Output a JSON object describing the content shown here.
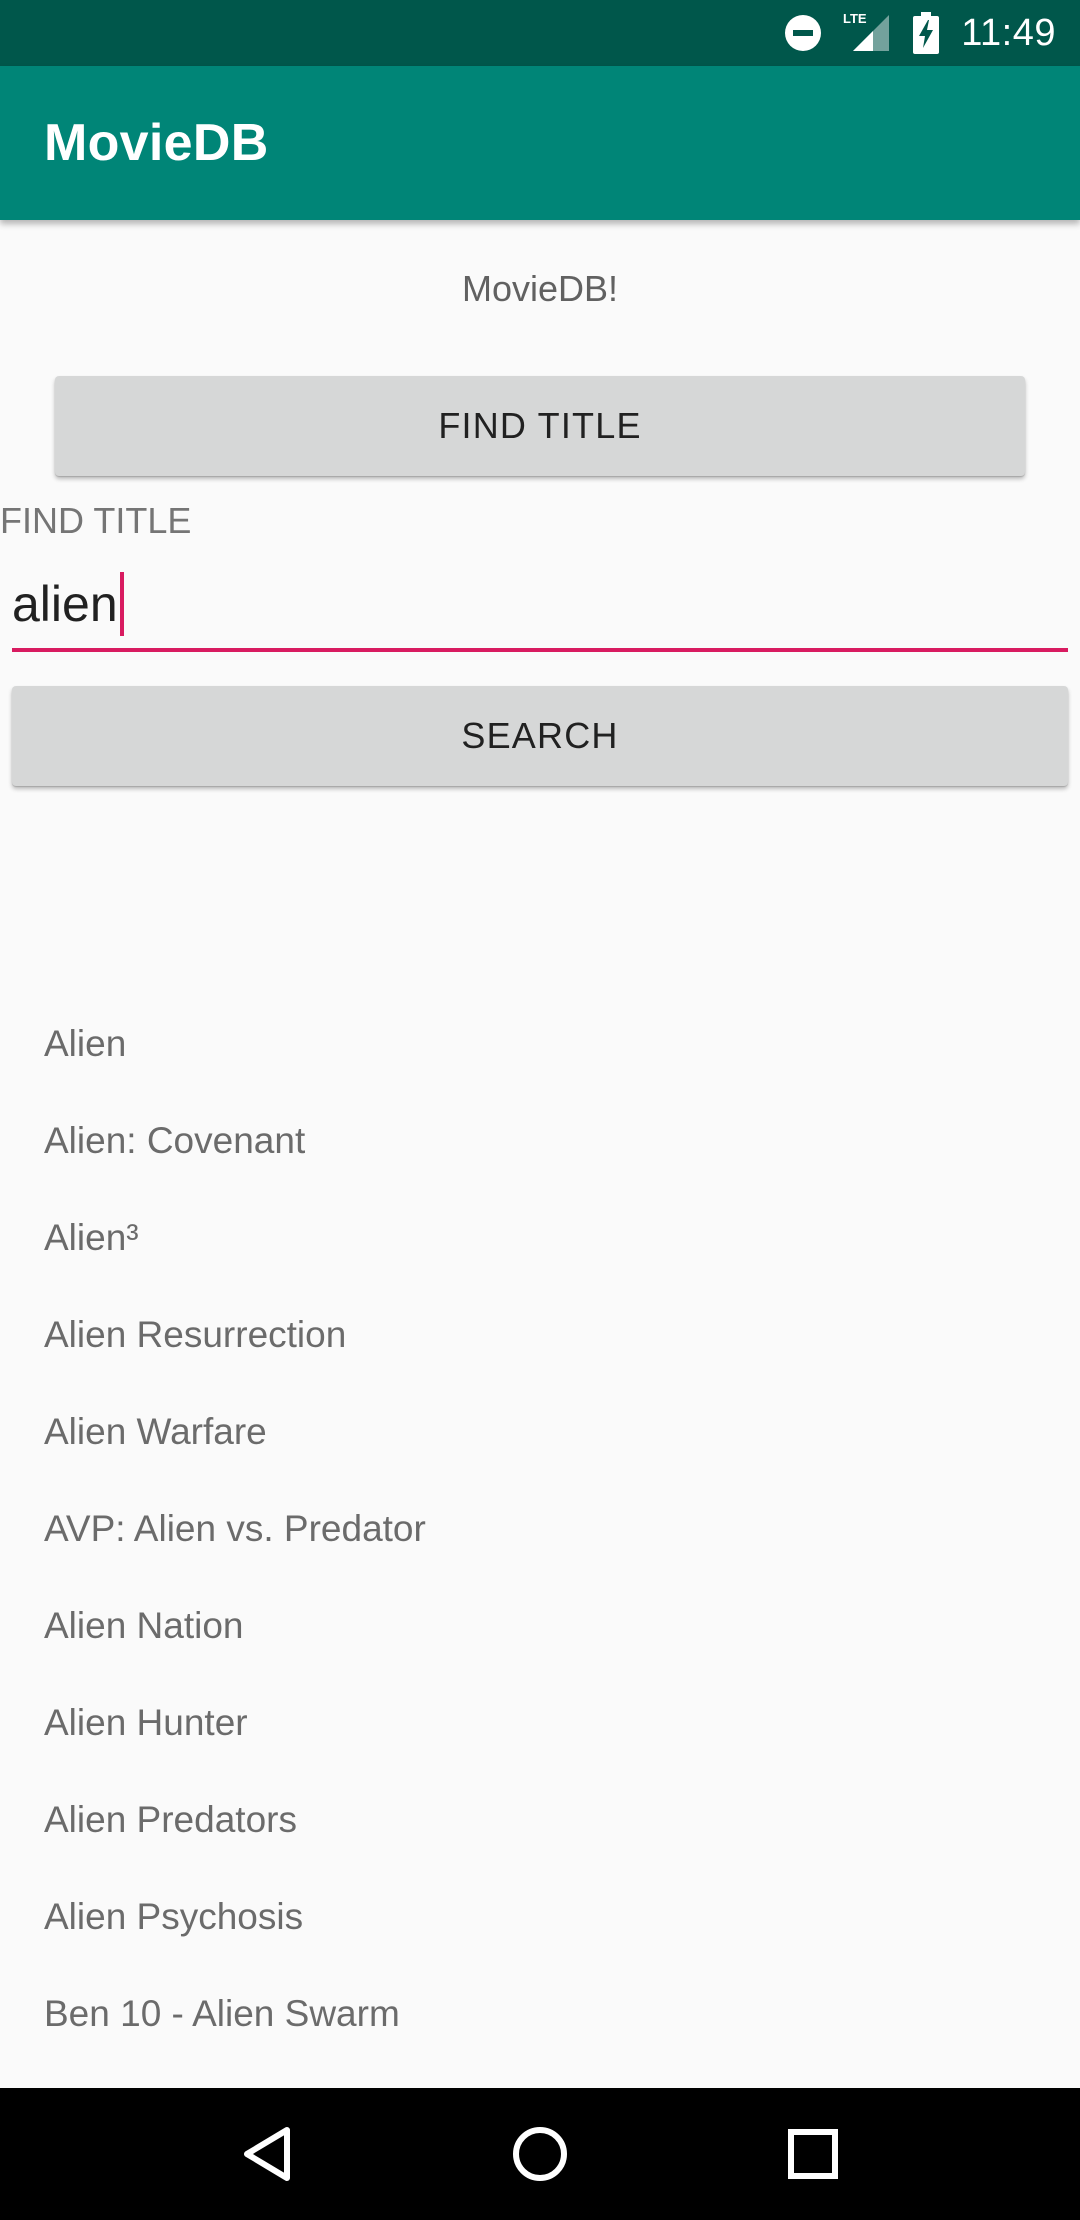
{
  "status_bar": {
    "time": "11:49",
    "icons": [
      "do-not-disturb-icon",
      "lte-signal-icon",
      "battery-charging-icon"
    ],
    "network_label": "LTE"
  },
  "app_bar": {
    "title": "MovieDB"
  },
  "main": {
    "welcome_text": "MovieDB!",
    "find_title_button": "FIND TITLE",
    "field_label": "FIND TITLE",
    "search_value": "alien",
    "search_button": "SEARCH",
    "results": [
      "Alien",
      "Alien: Covenant",
      "Alien³",
      "Alien Resurrection",
      "Alien Warfare",
      "AVP: Alien vs. Predator",
      "Alien Nation",
      "Alien Hunter",
      "Alien Predators",
      "Alien Psychosis",
      "Ben 10 - Alien Swarm"
    ]
  },
  "nav_bar": {
    "icons": [
      "back-icon",
      "home-icon",
      "recents-icon"
    ]
  },
  "colors": {
    "status_bar": "#00574b",
    "app_bar": "#008577",
    "accent": "#d81b60",
    "button": "#d6d7d7",
    "background": "#fafafa"
  }
}
